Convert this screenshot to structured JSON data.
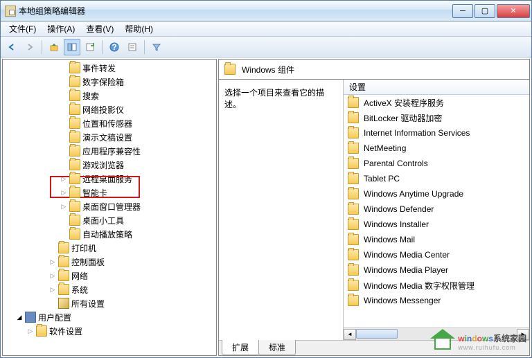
{
  "window": {
    "title": "本地组策略编辑器"
  },
  "menu": {
    "file": "文件(F)",
    "action": "操作(A)",
    "view": "查看(V)",
    "help": "帮助(H)"
  },
  "tree": {
    "items": [
      {
        "indent": 5,
        "icon": "folder",
        "label": "事件转发",
        "exp": ""
      },
      {
        "indent": 5,
        "icon": "folder",
        "label": "数字保险箱",
        "exp": ""
      },
      {
        "indent": 5,
        "icon": "folder",
        "label": "搜索",
        "exp": ""
      },
      {
        "indent": 5,
        "icon": "folder",
        "label": "网络投影仪",
        "exp": ""
      },
      {
        "indent": 5,
        "icon": "folder",
        "label": "位置和传感器",
        "exp": ""
      },
      {
        "indent": 5,
        "icon": "folder",
        "label": "演示文稿设置",
        "exp": ""
      },
      {
        "indent": 5,
        "icon": "folder",
        "label": "应用程序兼容性",
        "exp": "",
        "highlight": true
      },
      {
        "indent": 5,
        "icon": "folder",
        "label": "游戏浏览器",
        "exp": ""
      },
      {
        "indent": 5,
        "icon": "folder",
        "label": "远程桌面服务",
        "exp": "▷"
      },
      {
        "indent": 5,
        "icon": "folder",
        "label": "智能卡",
        "exp": "▷"
      },
      {
        "indent": 5,
        "icon": "folder",
        "label": "桌面窗口管理器",
        "exp": "▷"
      },
      {
        "indent": 5,
        "icon": "folder",
        "label": "桌面小工具",
        "exp": ""
      },
      {
        "indent": 5,
        "icon": "folder",
        "label": "自动播放策略",
        "exp": ""
      },
      {
        "indent": 4,
        "icon": "folder",
        "label": "打印机",
        "exp": ""
      },
      {
        "indent": 4,
        "icon": "folder",
        "label": "控制面板",
        "exp": "▷"
      },
      {
        "indent": 4,
        "icon": "folder",
        "label": "网络",
        "exp": "▷"
      },
      {
        "indent": 4,
        "icon": "folder",
        "label": "系统",
        "exp": "▷"
      },
      {
        "indent": 4,
        "icon": "settings",
        "label": "所有设置",
        "exp": ""
      },
      {
        "indent": 1,
        "icon": "comp",
        "label": "用户配置",
        "exp": "◢"
      },
      {
        "indent": 2,
        "icon": "folder",
        "label": "软件设置",
        "exp": "▷"
      }
    ]
  },
  "detail": {
    "header": "Windows 组件",
    "description": "选择一个项目来查看它的描述。",
    "column": "设置",
    "items": [
      "ActiveX 安装程序服务",
      "BitLocker 驱动器加密",
      "Internet Information Services",
      "NetMeeting",
      "Parental Controls",
      "Tablet PC",
      "Windows Anytime Upgrade",
      "Windows Defender",
      "Windows Installer",
      "Windows Mail",
      "Windows Media Center",
      "Windows Media Player",
      "Windows Media 数字权限管理",
      "Windows Messenger"
    ],
    "tab_extended": "扩展",
    "tab_standard": "标准"
  },
  "watermark": {
    "brand": "windows",
    "suffix": "系统家园",
    "url": "www.ruihufu.com"
  }
}
